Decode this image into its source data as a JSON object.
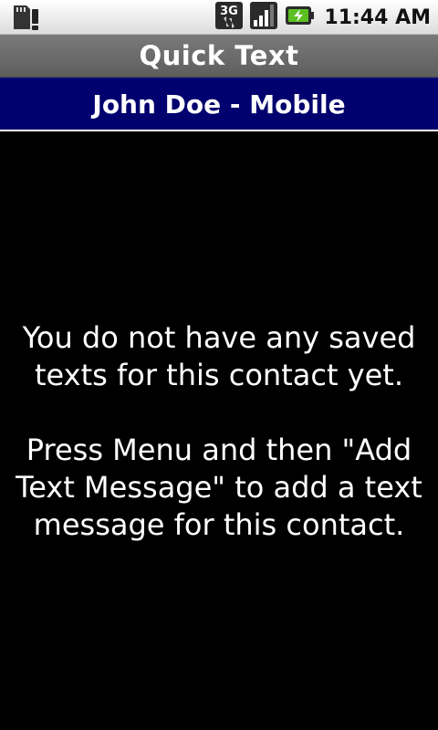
{
  "status_bar": {
    "time": "11:44 AM",
    "network_type": "3G",
    "icons": [
      "sd-card-warning-icon",
      "network-3g-icon",
      "signal-strength-icon",
      "battery-charging-icon"
    ]
  },
  "app": {
    "title": "Quick Text"
  },
  "contact": {
    "header": "John Doe - Mobile"
  },
  "empty_state": {
    "line1": "You do not have any saved texts for this contact yet.",
    "line2": "Press Menu and then \"Add Text Message\" to add a text message for this contact."
  },
  "colors": {
    "title_bar": "#6b6b6b",
    "contact_bar": "#00006e",
    "background": "#000000",
    "text": "#ffffff"
  }
}
